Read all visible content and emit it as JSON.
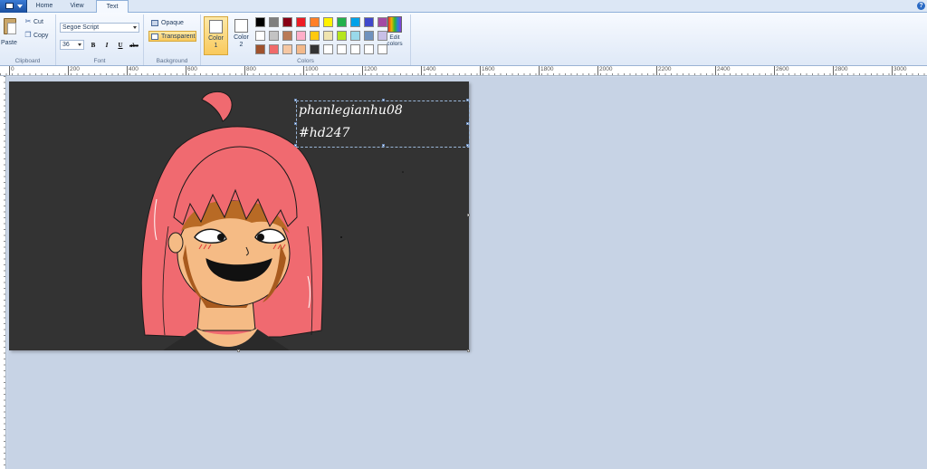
{
  "tabs": [
    {
      "label": "Home",
      "active": false
    },
    {
      "label": "View",
      "active": false
    },
    {
      "label": "Text",
      "active": true
    }
  ],
  "clipboard": {
    "paste_label": "Paste",
    "cut_label": "Cut",
    "copy_label": "Copy",
    "group_label": "Clipboard"
  },
  "font": {
    "family_value": "Segoe Script",
    "size_value": "36",
    "bold_label": "B",
    "italic_label": "I",
    "underline_label": "U",
    "strike_label": "abc",
    "group_label": "Font"
  },
  "background": {
    "opaque_label": "Opaque",
    "transparent_label": "Transparent",
    "selected": "transparent",
    "group_label": "Background"
  },
  "colors": {
    "color1_label": "Color",
    "color1_num": "1",
    "color1_value": "#ffffff",
    "color2_label": "Color",
    "color2_num": "2",
    "color2_value": "#ffffff",
    "edit_label": "Edit colors",
    "group_label": "Colors",
    "palette": [
      "#000000",
      "#7f7f7f",
      "#880015",
      "#ed1c24",
      "#ff7f27",
      "#fff200",
      "#22b14c",
      "#00a2e8",
      "#3f48cc",
      "#a349a4",
      "#ffffff",
      "#c3c3c3",
      "#b97a57",
      "#ffaec9",
      "#ffc90e",
      "#efe4b0",
      "#b5e61d",
      "#99d9ea",
      "#7092be",
      "#c8bfe7",
      "#a0522d",
      "#f06a6a",
      "#f5c7a3",
      "#f3b98a",
      "#333333",
      "#ffffff",
      "#ffffff",
      "#ffffff",
      "#ffffff",
      "#ffffff"
    ]
  },
  "ruler": {
    "labels": [
      "0",
      "200",
      "400",
      "600",
      "800",
      "1000",
      "1200",
      "1400",
      "1600",
      "1800",
      "2000",
      "2200",
      "2400",
      "2600",
      "2800",
      "3000"
    ]
  },
  "textbox": {
    "line1": "phanlegianhu08",
    "line2": "#hd247"
  },
  "accent_color": "#f9c95c",
  "canvas_bg": "#333333",
  "hair_color": "#f06a70",
  "skin_color": "#f5bb85"
}
